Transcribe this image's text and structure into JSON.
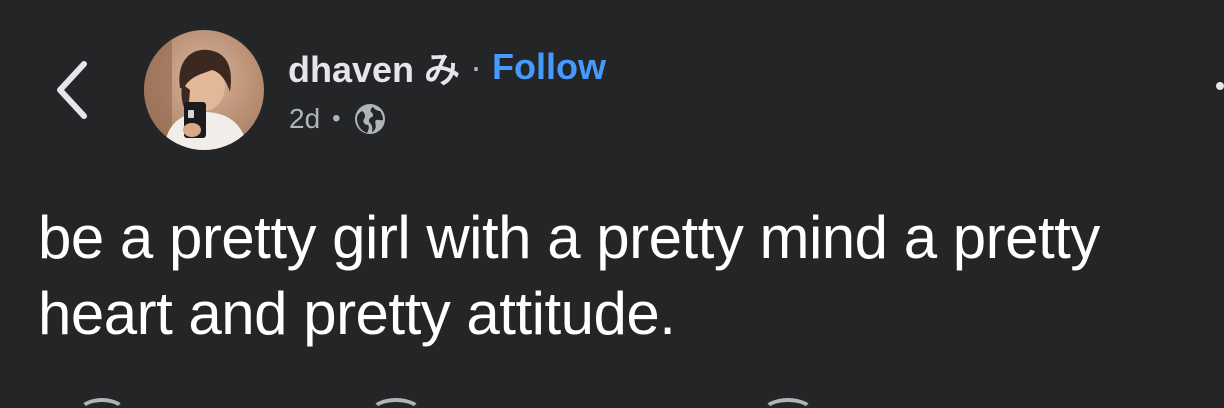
{
  "author": {
    "name": "dhaven み",
    "follow_label": "Follow"
  },
  "meta": {
    "time_ago": "2d",
    "audience_icon": "globe-icon"
  },
  "post": {
    "text": "be a pretty girl with a pretty mind a pretty heart and pretty attitude."
  },
  "icons": {
    "back": "chevron-left-icon",
    "more": "more-options-icon"
  },
  "colors": {
    "background": "#242526",
    "text_primary": "#e4e6eb",
    "text_secondary": "#b0b3b8",
    "link": "#4599ff"
  }
}
